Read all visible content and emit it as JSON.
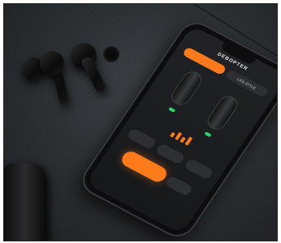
{
  "photo": {
    "subject": "",
    "phone_app": {
      "brand": "DEBOPTER",
      "tabs": [
        "",
        "LIFE STYLE"
      ]
    }
  },
  "colors": {
    "accent": "#ff7a1a",
    "battery": "#2ad46a"
  }
}
